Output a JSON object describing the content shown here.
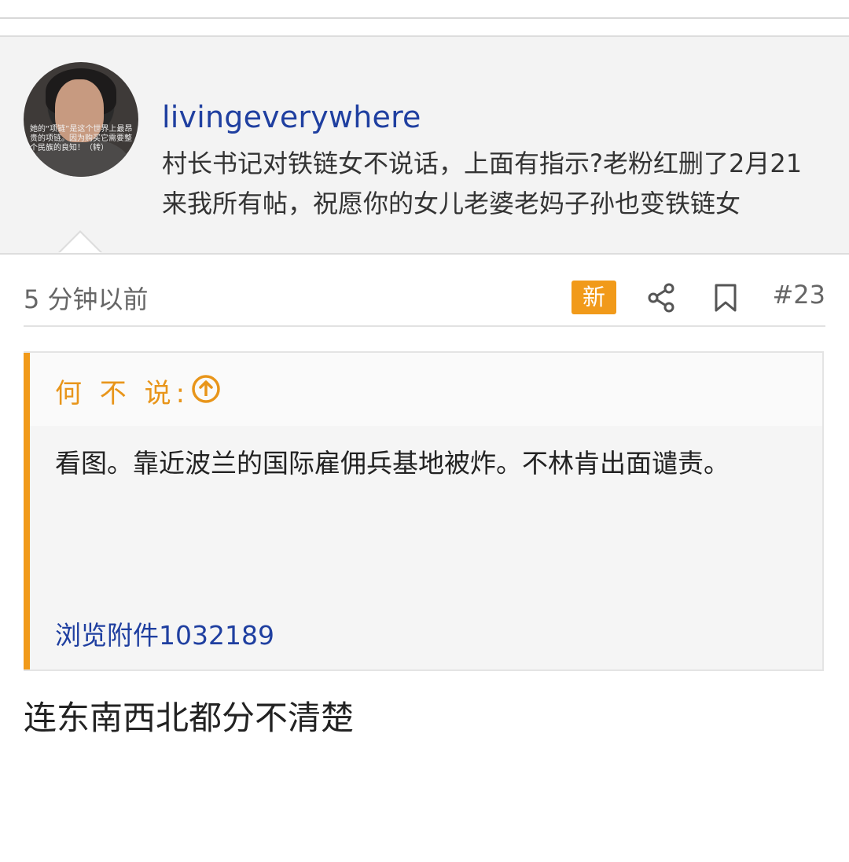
{
  "header": {
    "avatar_caption": "她的“项链”是这个世界上最昂贵的项链。因为购买它需要整个民族的良知！（转）",
    "username": "livingeverywhere",
    "signature": "村长书记对铁链女不说话，上面有指示?老粉红删了2月21来我所有帖，祝愿你的女儿老婆老妈子孙也变铁链女"
  },
  "post": {
    "timestamp": "5 分钟以前",
    "new_badge": "新",
    "number": "#23",
    "quote": {
      "author": "何 不 说:",
      "text": "看图。靠近波兰的国际雇佣兵基地被炸。不林肯出面谴责。",
      "attachment_link": "浏览附件1032189"
    },
    "reply": "连东南西北都分不清楚"
  },
  "icons": {
    "share": "share-icon",
    "bookmark": "bookmark-icon",
    "quote_up": "arrow-up-circle-icon"
  },
  "colors": {
    "accent_orange": "#f19a1a",
    "link_blue": "#1f3fa0"
  }
}
